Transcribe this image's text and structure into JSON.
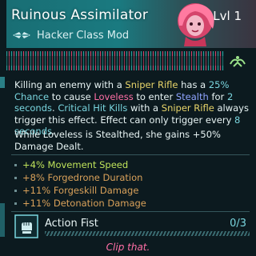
{
  "header": {
    "title": "Ruinous Assimilator",
    "class_icon": "hacker-wing-icon",
    "subtitle": "Hacker Class Mod",
    "level": "Lvl 1",
    "portrait": "loveless-portrait"
  },
  "bar": {
    "icon": "hacker-wing-icon"
  },
  "description": {
    "p1": [
      {
        "t": "Killing an enemy with a ",
        "c": ""
      },
      {
        "t": "Sniper Rifle",
        "c": "hl-sniper"
      },
      {
        "t": " has a ",
        "c": ""
      },
      {
        "t": "25% Chance",
        "c": "hl-cyan"
      },
      {
        "t": " to cause ",
        "c": ""
      },
      {
        "t": "Loveless",
        "c": "hl-pink"
      },
      {
        "t": " to enter ",
        "c": ""
      },
      {
        "t": "Stealth",
        "c": "hl-purple"
      },
      {
        "t": " for ",
        "c": ""
      },
      {
        "t": "2 seconds",
        "c": "hl-cyan"
      },
      {
        "t": ". ",
        "c": ""
      },
      {
        "t": "Critical Hit Kills",
        "c": "hl-cyan"
      },
      {
        "t": " with a ",
        "c": ""
      },
      {
        "t": "Sniper Rifle",
        "c": "hl-sniper"
      },
      {
        "t": " always trigger this effect. Effect can only trigger every ",
        "c": ""
      },
      {
        "t": "8 seconds",
        "c": "hl-cyan"
      },
      {
        "t": ".",
        "c": ""
      }
    ],
    "p2": [
      {
        "t": "While ",
        "c": ""
      },
      {
        "t": "Loveless",
        "c": "hl-pink"
      },
      {
        "t": " is ",
        "c": ""
      },
      {
        "t": "Stealthed",
        "c": "hl-purple"
      },
      {
        "t": ", she gains ",
        "c": ""
      },
      {
        "t": "+50% Damage Dealt",
        "c": "hl-cyan"
      },
      {
        "t": ".",
        "c": ""
      }
    ]
  },
  "bonuses": [
    "+4% Movement Speed",
    "+8% Forgedrone Duration",
    "+11% Forgeskill Damage",
    "+11% Detonation Damage"
  ],
  "skill": {
    "icon": "action-fist-icon",
    "name": "Action Fist",
    "count": "0/3"
  },
  "quote": "Clip that.",
  "colors": {
    "header_teal": "#1a7a80",
    "highlight_cyan": "#7ad6df",
    "highlight_pink": "#ff6fa6",
    "highlight_gold": "#e8d56a",
    "bonus_orange": "#d9a15a",
    "bonus_green": "#bfe35a"
  }
}
